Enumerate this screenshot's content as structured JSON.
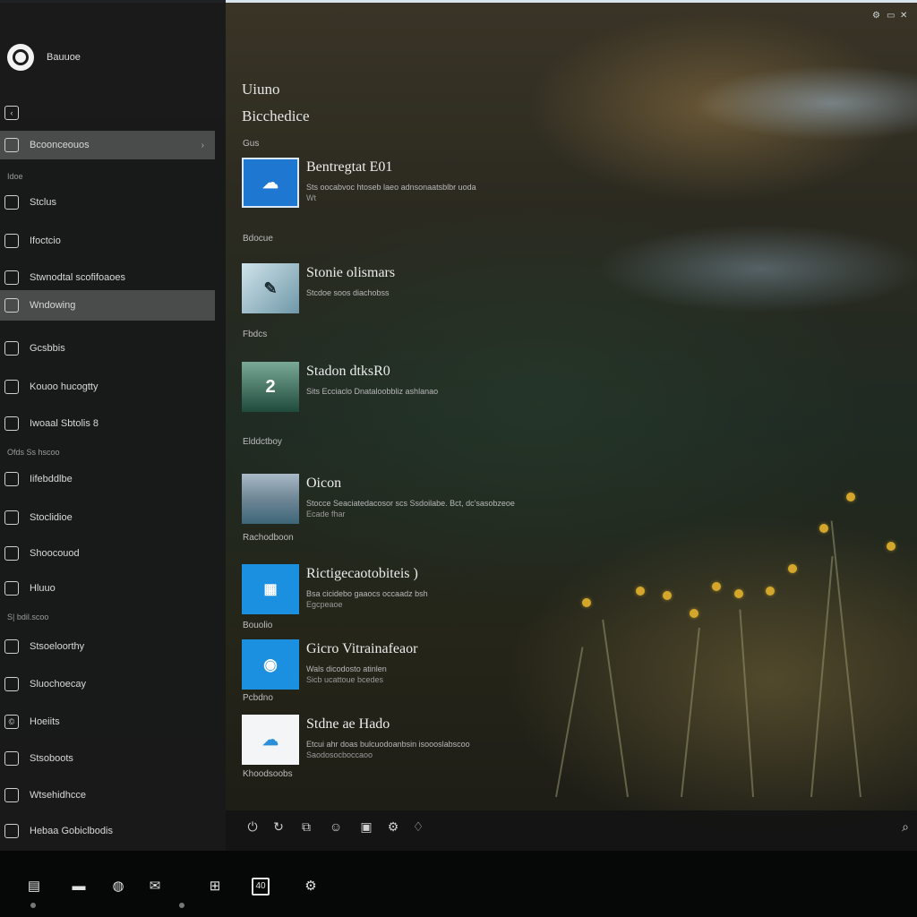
{
  "app": {
    "name": "Bauuoe",
    "top_icons": [
      "gear-icon",
      "minimize-icon",
      "close-icon"
    ]
  },
  "sidebar": {
    "back_label": "",
    "items": [
      {
        "label": "Bcoonceouos",
        "icon": "settings-icon",
        "active": true
      },
      {
        "label": "Stclus",
        "icon": "window-icon"
      },
      {
        "label": "Ifoctcio",
        "icon": "person-icon"
      },
      {
        "label": "Stwnodtal scofifoaoes",
        "icon": "network-icon"
      },
      {
        "label": "Wndowing",
        "icon": "window-icon",
        "active": true
      },
      {
        "label": "Gcsbbis",
        "icon": "chart-icon"
      },
      {
        "label": "Kouoo hucogtty",
        "icon": "display-icon"
      },
      {
        "label": "Iwoaal Sbtolis 8",
        "icon": "monitor-icon"
      },
      {
        "label": "Iifebddlbe",
        "icon": "shield-icon"
      },
      {
        "label": "Stoclidioe",
        "icon": "folder-icon"
      },
      {
        "label": "Shoocouod",
        "icon": "device-icon"
      },
      {
        "label": "Hluuo",
        "icon": "cloud-icon"
      },
      {
        "label": "Stsoeloorthy",
        "icon": "globe-icon"
      },
      {
        "label": "Sluochoecay",
        "icon": "clock-icon"
      },
      {
        "label": "Hoeiits",
        "icon": "copyright-icon"
      },
      {
        "label": "Stsoboots",
        "icon": "apps-icon"
      },
      {
        "label": "Wtsehidhcce",
        "icon": "tools-icon"
      },
      {
        "label": "Hebaa Gobiclbodis",
        "icon": "help-icon"
      }
    ],
    "sections": [
      "Idoe",
      "Ofds Ss hscoo",
      "S| bdil.scoo"
    ]
  },
  "main": {
    "title": "Uiuno",
    "subtitle": "Bicchedice",
    "sections": [
      "Gus",
      "Bdocue",
      "Fbdcs",
      "Elddctboy",
      "Rachodboon",
      "Bouolio",
      "Pcbdno",
      "Khoodsoobs"
    ],
    "items": [
      {
        "title": "Bentregtat E01",
        "desc": "Sts oocabvoc htoseb laeo adnsonaatsblbr uoda",
        "desc2": "Wt",
        "thumb": "blue-cloud-icon"
      },
      {
        "title": "Stonie olismars",
        "desc": "Stcdoe soos diachobss",
        "desc2": "",
        "thumb": "landscape-icon"
      },
      {
        "title": "Stadon dtksR0",
        "desc": "Sits Ecciaclo Dnataloobbliz ashlanao",
        "desc2": "",
        "thumb": "app-icon"
      },
      {
        "title": "Oicon",
        "desc": "Stocce Seaciatedacosor scs Ssdoilabe. Bct, dc'sasobzeoe",
        "desc2": "Ecade fhar",
        "thumb": "landscape-icon"
      },
      {
        "title": "Rictigecaotobiteis )",
        "desc": "Bsa cicidebo gaaocs occaadz bsh",
        "desc2": "Egcpeaoe",
        "thumb": "store-icon"
      },
      {
        "title": "Gicro Vitrainafeaor",
        "desc": "Wals dicodosto atinlen",
        "desc2": "Sicb ucattoue bcedes",
        "thumb": "edge-icon"
      },
      {
        "title": "Stdne ae Hado",
        "desc": "Etcui ahr doas bulcuodoanbsin isoooslabscoo",
        "desc2": "Saodosocboccaoo",
        "thumb": "cloud-icon"
      }
    ]
  },
  "bottom_bar": {
    "icons": [
      "power-icon",
      "refresh-icon",
      "copy-icon",
      "emoji-icon",
      "gallery-icon",
      "settings-icon",
      "drop-icon"
    ],
    "right_icon": "search-icon"
  },
  "taskbar": {
    "icons": [
      "gallery-icon",
      "folder-icon",
      "edge-icon",
      "mail-icon",
      "store-icon",
      "box-icon",
      "settings-icon"
    ],
    "box_label": "40"
  },
  "colors": {
    "accent": "#1e88e5",
    "sidebar_bg": "#181919",
    "active_bg": "#4a4b4b",
    "taskbar_bg": "#060707"
  }
}
